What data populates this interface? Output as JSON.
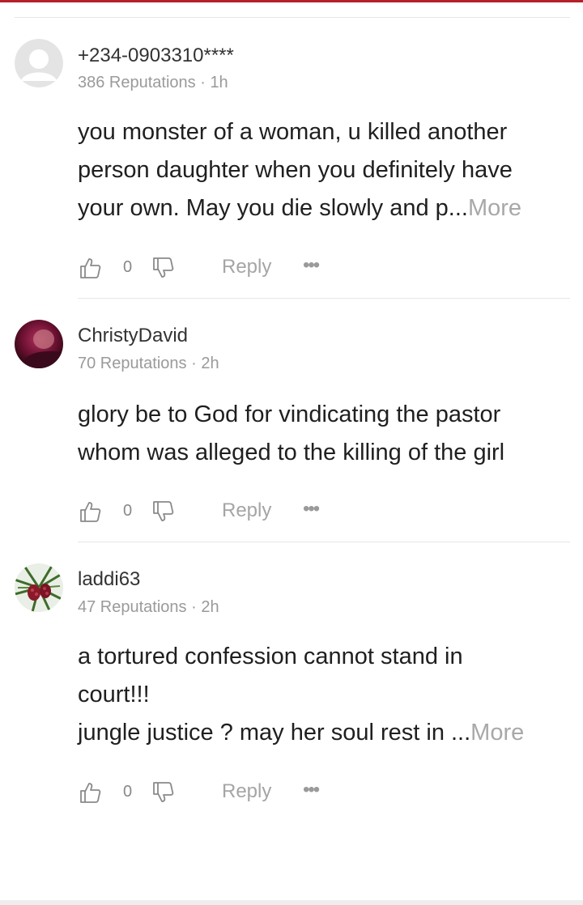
{
  "comments": [
    {
      "username": "+234-0903310****",
      "meta": "386 Reputations · 1h",
      "lines": [
        "you monster of a woman, u killed another",
        "person daughter when you definitely have",
        "your own. May you die slowly and p..."
      ],
      "more_label": "More",
      "like_count": "0",
      "reply_label": "Reply",
      "more_actions": "•••",
      "avatar_icon": "default-user-avatar-icon"
    },
    {
      "username": "ChristyDavid",
      "meta": "70 Reputations · 2h",
      "lines": [
        "glory be to God for vindicating the pastor",
        "whom was alleged to the killing of the girl"
      ],
      "more_label": "",
      "like_count": "0",
      "reply_label": "Reply",
      "more_actions": "•••",
      "avatar_icon": "user-photo-avatar"
    },
    {
      "username": "laddi63",
      "meta": "47 Reputations · 2h",
      "lines": [
        "a tortured confession cannot stand in",
        "court!!!",
        "jungle justice ? may her soul rest in ..."
      ],
      "more_label": "More",
      "like_count": "0",
      "reply_label": "Reply",
      "more_actions": "•••",
      "avatar_icon": "user-photo-avatar"
    }
  ],
  "colors": {
    "accent_top": "#b5202a",
    "muted_text": "#9a9a9a",
    "body_text": "#1f1f1f"
  }
}
